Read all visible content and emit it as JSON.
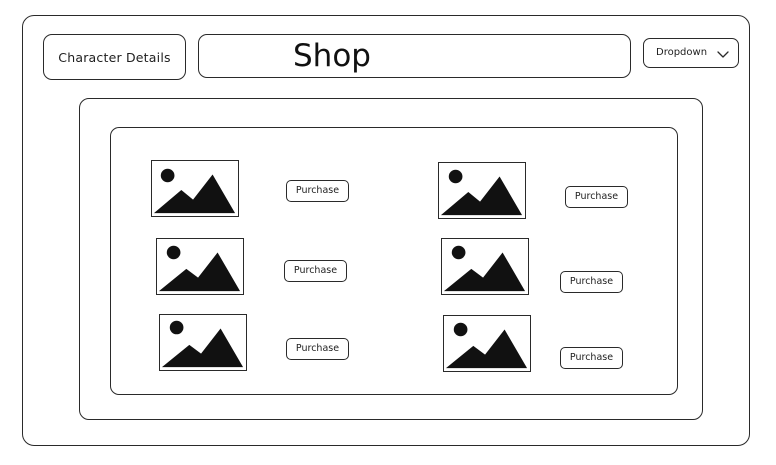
{
  "header": {
    "character_details_label": "Character Details",
    "title": "Shop",
    "dropdown": {
      "selected": "Dropdown",
      "icon": "chevron-down-icon"
    }
  },
  "shop": {
    "items": [
      {
        "image_icon": "image-placeholder-icon",
        "button_label": "Purchase"
      },
      {
        "image_icon": "image-placeholder-icon",
        "button_label": "Purchase"
      },
      {
        "image_icon": "image-placeholder-icon",
        "button_label": "Purchase"
      },
      {
        "image_icon": "image-placeholder-icon",
        "button_label": "Purchase"
      },
      {
        "image_icon": "image-placeholder-icon",
        "button_label": "Purchase"
      },
      {
        "image_icon": "image-placeholder-icon",
        "button_label": "Purchase"
      }
    ]
  }
}
